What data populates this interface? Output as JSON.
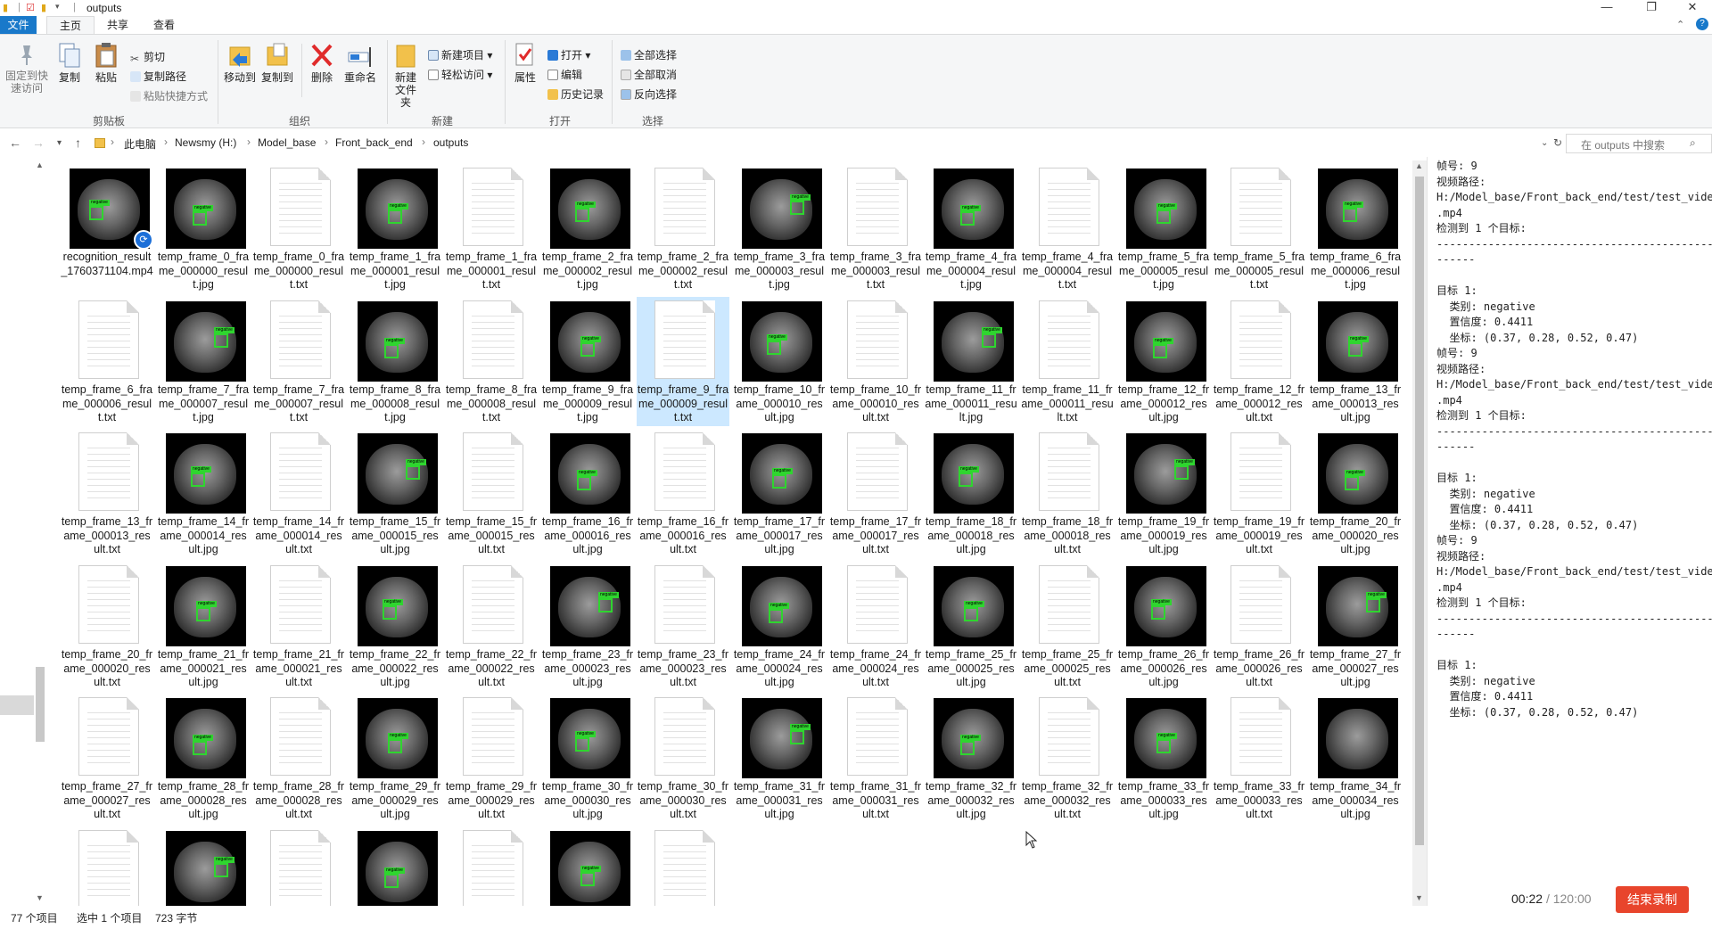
{
  "window": {
    "title": "outputs",
    "controls": [
      "—",
      "❐",
      "✕"
    ]
  },
  "ribbon": {
    "tabs": [
      "文件",
      "主页",
      "共享",
      "查看"
    ],
    "clipboard": {
      "pin_label": "固定到快速访问",
      "copy_label": "复制",
      "paste_label": "粘贴",
      "cut_label": "剪切",
      "copy_path_label": "复制路径",
      "paste_shortcut_label": "粘贴快捷方式",
      "group_label": "剪贴板"
    },
    "organize": {
      "move_to_label": "移动到",
      "copy_to_label": "复制到",
      "delete_label": "删除",
      "rename_label": "重命名",
      "group_label": "组织"
    },
    "new": {
      "new_folder_label": "新建文件夹",
      "new_item_label": "新建项目",
      "easy_access_label": "轻松访问",
      "group_label": "新建"
    },
    "open": {
      "properties_label": "属性",
      "open_label": "打开",
      "edit_label": "编辑",
      "history_label": "历史记录",
      "group_label": "打开"
    },
    "select": {
      "select_all_label": "全部选择",
      "select_none_label": "全部取消",
      "invert_label": "反向选择",
      "group_label": "选择"
    }
  },
  "address": {
    "crumbs": [
      "此电脑",
      "Newsmy (H:)",
      "Model_base",
      "Front_back_end",
      "outputs"
    ],
    "search_placeholder": "在 outputs 中搜索"
  },
  "files": [
    {
      "name": "recognition_result_1760371104.mp4",
      "type": "video"
    },
    {
      "name": "temp_frame_0_frame_000000_result.jpg",
      "type": "img"
    },
    {
      "name": "temp_frame_0_frame_000000_result.txt",
      "type": "txt"
    },
    {
      "name": "temp_frame_1_frame_000001_result.jpg",
      "type": "img"
    },
    {
      "name": "temp_frame_1_frame_000001_result.txt",
      "type": "txt"
    },
    {
      "name": "temp_frame_2_frame_000002_result.jpg",
      "type": "img"
    },
    {
      "name": "temp_frame_2_frame_000002_result.txt",
      "type": "txt"
    },
    {
      "name": "temp_frame_3_frame_000003_result.jpg",
      "type": "img"
    },
    {
      "name": "temp_frame_3_frame_000003_result.txt",
      "type": "txt"
    },
    {
      "name": "temp_frame_4_frame_000004_result.jpg",
      "type": "img"
    },
    {
      "name": "temp_frame_4_frame_000004_result.txt",
      "type": "txt"
    },
    {
      "name": "temp_frame_5_frame_000005_result.jpg",
      "type": "img"
    },
    {
      "name": "temp_frame_5_frame_000005_result.txt",
      "type": "txt"
    },
    {
      "name": "temp_frame_6_frame_000006_result.jpg",
      "type": "img"
    },
    {
      "name": "temp_frame_6_frame_000006_result.txt",
      "type": "txt"
    },
    {
      "name": "temp_frame_7_frame_000007_result.jpg",
      "type": "img"
    },
    {
      "name": "temp_frame_7_frame_000007_result.txt",
      "type": "txt"
    },
    {
      "name": "temp_frame_8_frame_000008_result.jpg",
      "type": "img"
    },
    {
      "name": "temp_frame_8_frame_000008_result.txt",
      "type": "txt"
    },
    {
      "name": "temp_frame_9_frame_000009_result.jpg",
      "type": "img"
    },
    {
      "name": "temp_frame_9_frame_000009_result.txt",
      "type": "txt",
      "selected": true
    },
    {
      "name": "temp_frame_10_frame_000010_result.jpg",
      "type": "img"
    },
    {
      "name": "temp_frame_10_frame_000010_result.txt",
      "type": "txt"
    },
    {
      "name": "temp_frame_11_frame_000011_result.jpg",
      "type": "img"
    },
    {
      "name": "temp_frame_11_frame_000011_result.txt",
      "type": "txt"
    },
    {
      "name": "temp_frame_12_frame_000012_result.jpg",
      "type": "img"
    },
    {
      "name": "temp_frame_12_frame_000012_result.txt",
      "type": "txt"
    },
    {
      "name": "temp_frame_13_frame_000013_result.jpg",
      "type": "img"
    },
    {
      "name": "temp_frame_13_frame_000013_result.txt",
      "type": "txt"
    },
    {
      "name": "temp_frame_14_frame_000014_result.jpg",
      "type": "img"
    },
    {
      "name": "temp_frame_14_frame_000014_result.txt",
      "type": "txt"
    },
    {
      "name": "temp_frame_15_frame_000015_result.jpg",
      "type": "img"
    },
    {
      "name": "temp_frame_15_frame_000015_result.txt",
      "type": "txt"
    },
    {
      "name": "temp_frame_16_frame_000016_result.jpg",
      "type": "img"
    },
    {
      "name": "temp_frame_16_frame_000016_result.txt",
      "type": "txt"
    },
    {
      "name": "temp_frame_17_frame_000017_result.jpg",
      "type": "img"
    },
    {
      "name": "temp_frame_17_frame_000017_result.txt",
      "type": "txt"
    },
    {
      "name": "temp_frame_18_frame_000018_result.jpg",
      "type": "img"
    },
    {
      "name": "temp_frame_18_frame_000018_result.txt",
      "type": "txt"
    },
    {
      "name": "temp_frame_19_frame_000019_result.jpg",
      "type": "img"
    },
    {
      "name": "temp_frame_19_frame_000019_result.txt",
      "type": "txt"
    },
    {
      "name": "temp_frame_20_frame_000020_result.jpg",
      "type": "img"
    },
    {
      "name": "temp_frame_20_frame_000020_result.txt",
      "type": "txt"
    },
    {
      "name": "temp_frame_21_frame_000021_result.jpg",
      "type": "img"
    },
    {
      "name": "temp_frame_21_frame_000021_result.txt",
      "type": "txt"
    },
    {
      "name": "temp_frame_22_frame_000022_result.jpg",
      "type": "img"
    },
    {
      "name": "temp_frame_22_frame_000022_result.txt",
      "type": "txt"
    },
    {
      "name": "temp_frame_23_frame_000023_result.jpg",
      "type": "img"
    },
    {
      "name": "temp_frame_23_frame_000023_result.txt",
      "type": "txt"
    },
    {
      "name": "temp_frame_24_frame_000024_result.jpg",
      "type": "img"
    },
    {
      "name": "temp_frame_24_frame_000024_result.txt",
      "type": "txt"
    },
    {
      "name": "temp_frame_25_frame_000025_result.jpg",
      "type": "img"
    },
    {
      "name": "temp_frame_25_frame_000025_result.txt",
      "type": "txt"
    },
    {
      "name": "temp_frame_26_frame_000026_result.jpg",
      "type": "img"
    },
    {
      "name": "temp_frame_26_frame_000026_result.txt",
      "type": "txt"
    },
    {
      "name": "temp_frame_27_frame_000027_result.jpg",
      "type": "img"
    },
    {
      "name": "temp_frame_27_frame_000027_result.txt",
      "type": "txt"
    },
    {
      "name": "temp_frame_28_frame_000028_result.jpg",
      "type": "img"
    },
    {
      "name": "temp_frame_28_frame_000028_result.txt",
      "type": "txt"
    },
    {
      "name": "temp_frame_29_frame_000029_result.jpg",
      "type": "img"
    },
    {
      "name": "temp_frame_29_frame_000029_result.txt",
      "type": "txt"
    },
    {
      "name": "temp_frame_30_frame_000030_result.jpg",
      "type": "img"
    },
    {
      "name": "temp_frame_30_frame_000030_result.txt",
      "type": "txt"
    },
    {
      "name": "temp_frame_31_frame_000031_result.jpg",
      "type": "img"
    },
    {
      "name": "temp_frame_31_frame_000031_result.txt",
      "type": "txt"
    },
    {
      "name": "temp_frame_32_frame_000032_result.jpg",
      "type": "img"
    },
    {
      "name": "temp_frame_32_frame_000032_result.txt",
      "type": "txt"
    },
    {
      "name": "temp_frame_33_frame_000033_result.jpg",
      "type": "img"
    },
    {
      "name": "temp_frame_33_frame_000033_result.txt",
      "type": "txt"
    },
    {
      "name": "temp_frame_34_frame_000034_result.jpg",
      "type": "img"
    },
    {
      "name": "",
      "type": "txt"
    },
    {
      "name": "",
      "type": "img"
    },
    {
      "name": "",
      "type": "txt"
    },
    {
      "name": "",
      "type": "img"
    },
    {
      "name": "",
      "type": "txt"
    },
    {
      "name": "",
      "type": "img"
    },
    {
      "name": "",
      "type": "txt"
    }
  ],
  "thumb_label": "negative",
  "preview": {
    "blocks": [
      {
        "frame": "帧号: 9",
        "path_label": "视频路径:",
        "path": "H:/Model_base/Front_back_end/test/test_video",
        "path_end": ".mp4",
        "detected": "检测到 1 个目标:",
        "rule1": "--------------------------------------------------",
        "rule2": "------",
        "target": "目标 1:",
        "cls": "  类别: negative",
        "conf": "  置信度: 0.4411",
        "coords": "  坐标: (0.37, 0.28, 0.52, 0.47)"
      },
      {
        "frame": "帧号: 9",
        "path_label": "视频路径:",
        "path": "H:/Model_base/Front_back_end/test/test_video",
        "path_end": ".mp4",
        "detected": "检测到 1 个目标:",
        "rule1": "--------------------------------------------------",
        "rule2": "------",
        "target": "目标 1:",
        "cls": "  类别: negative",
        "conf": "  置信度: 0.4411",
        "coords": "  坐标: (0.37, 0.28, 0.52, 0.47)"
      },
      {
        "frame": "帧号: 9",
        "path_label": "视频路径:",
        "path": "H:/Model_base/Front_back_end/test/test_video",
        "path_end": ".mp4",
        "detected": "检测到 1 个目标:",
        "rule1": "--------------------------------------------------",
        "rule2": "------",
        "target": "目标 1:",
        "cls": "  类别: negative",
        "conf": "  置信度: 0.4411",
        "coords": "  坐标: (0.37, 0.28, 0.52, 0.47)"
      }
    ]
  },
  "status": {
    "count": "77 个项目",
    "selected": "选中 1 个项目",
    "size": "723 字节"
  },
  "recorder": {
    "elapsed": "00:22",
    "total": "/ 120:00",
    "stop_label": "结束录制"
  },
  "colors": {
    "file_tab": "#1979ca",
    "selection": "#cce8ff",
    "detection": "#2fd52f",
    "stop_button": "#e8452c"
  }
}
